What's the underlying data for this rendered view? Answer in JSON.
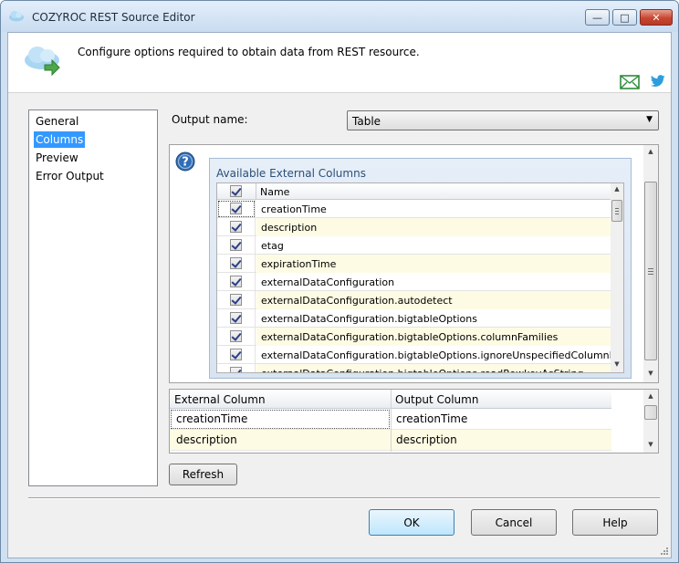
{
  "window": {
    "title": "COZYROC REST Source Editor",
    "minimize_glyph": "—",
    "maximize_glyph": "□",
    "close_glyph": "✕"
  },
  "header": {
    "description": "Configure options required to obtain data from REST resource."
  },
  "nav": {
    "items": [
      {
        "label": "General"
      },
      {
        "label": "Columns",
        "selected": true
      },
      {
        "label": "Preview"
      },
      {
        "label": "Error Output"
      }
    ]
  },
  "output": {
    "label": "Output name:",
    "value": "Table",
    "arrow": "▼"
  },
  "available": {
    "title": "Available External Columns",
    "header": "Name",
    "rows": [
      {
        "name": "creationTime",
        "checked": true
      },
      {
        "name": "description",
        "checked": true
      },
      {
        "name": "etag",
        "checked": true
      },
      {
        "name": "expirationTime",
        "checked": true
      },
      {
        "name": "externalDataConfiguration",
        "checked": true
      },
      {
        "name": "externalDataConfiguration.autodetect",
        "checked": true
      },
      {
        "name": "externalDataConfiguration.bigtableOptions",
        "checked": true
      },
      {
        "name": "externalDataConfiguration.bigtableOptions.columnFamilies",
        "checked": true
      },
      {
        "name": "externalDataConfiguration.bigtableOptions.ignoreUnspecifiedColumnFamilies",
        "checked": true
      },
      {
        "name": "externalDataConfiguration.bigtableOptions.readRowkeyAsString",
        "checked": true
      }
    ]
  },
  "mapping": {
    "headers": {
      "external": "External Column",
      "output": "Output Column"
    },
    "rows": [
      {
        "external": "creationTime",
        "output": "creationTime"
      },
      {
        "external": "description",
        "output": "description"
      }
    ]
  },
  "scroll": {
    "up": "▲",
    "down": "▼"
  },
  "buttons": {
    "refresh": "Refresh",
    "ok": "OK",
    "cancel": "Cancel",
    "help": "Help"
  },
  "icons": {
    "app": "cloud-icon",
    "header": "cloud-arrow-icon",
    "mail": "mail-icon",
    "twitter": "twitter-icon",
    "help": "help-icon"
  },
  "colors": {
    "selection": "#3399ff",
    "alt_row": "#fdfbe3",
    "close_button": "#c74631",
    "group_title": "#2b4f77"
  }
}
